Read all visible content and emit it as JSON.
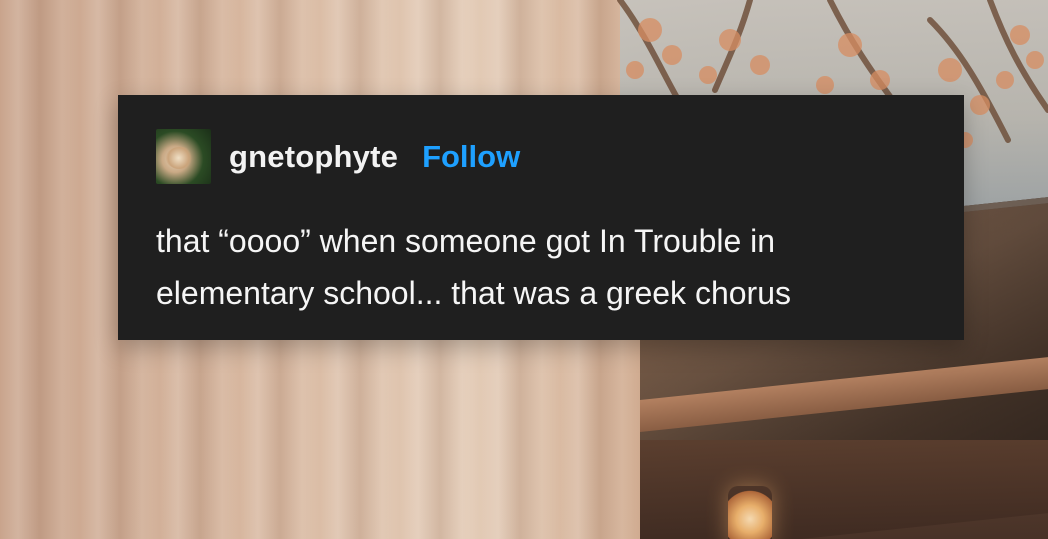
{
  "post": {
    "username": "gnetophyte",
    "follow_label": "Follow",
    "text_line_1": "that “oooo” when someone got In Trouble in",
    "text_line_2": "elementary school... that was a greek chorus"
  },
  "colors": {
    "post_background": "#1f1f1f",
    "follow_accent": "#1ea0ff",
    "text_primary": "#f5f5f5"
  },
  "icons": {
    "avatar": "avatar-image"
  }
}
